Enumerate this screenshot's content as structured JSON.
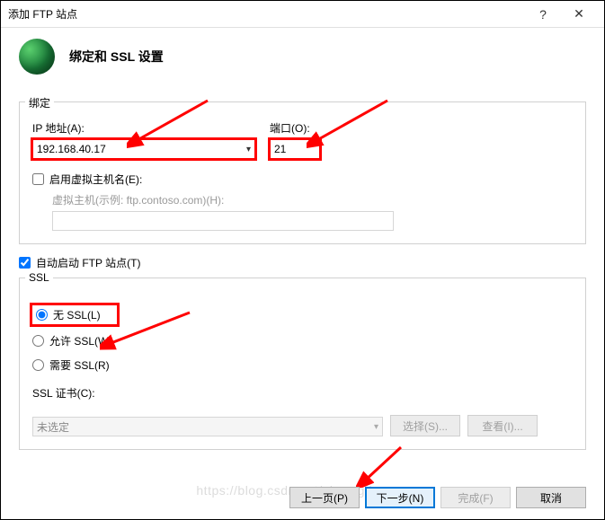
{
  "window": {
    "title": "添加 FTP 站点",
    "help": "?",
    "close": "✕"
  },
  "header": {
    "title": "绑定和 SSL 设置"
  },
  "binding": {
    "legend": "绑定",
    "ipLabel": "IP 地址(A):",
    "ipValue": "192.168.40.17",
    "portLabel": "端口(O):",
    "portValue": "21",
    "enableVHostLabel": "启用虚拟主机名(E):",
    "vhostHint": "虚拟主机(示例: ftp.contoso.com)(H):"
  },
  "autoStart": {
    "label": "自动启动 FTP 站点(T)",
    "checked": true
  },
  "ssl": {
    "legend": "SSL",
    "noSslLabel": "无 SSL(L)",
    "allowSslLabel": "允许 SSL(W)",
    "requireSslLabel": "需要 SSL(R)",
    "certLabel": "SSL 证书(C):",
    "certValue": "未选定",
    "selectBtn": "选择(S)...",
    "viewBtn": "查看(I)..."
  },
  "footer": {
    "prev": "上一页(P)",
    "next": "下一步(N)",
    "finish": "完成(F)",
    "cancel": "取消"
  },
  "watermark": "https://blog.csdn.net/aiwangtingyun"
}
